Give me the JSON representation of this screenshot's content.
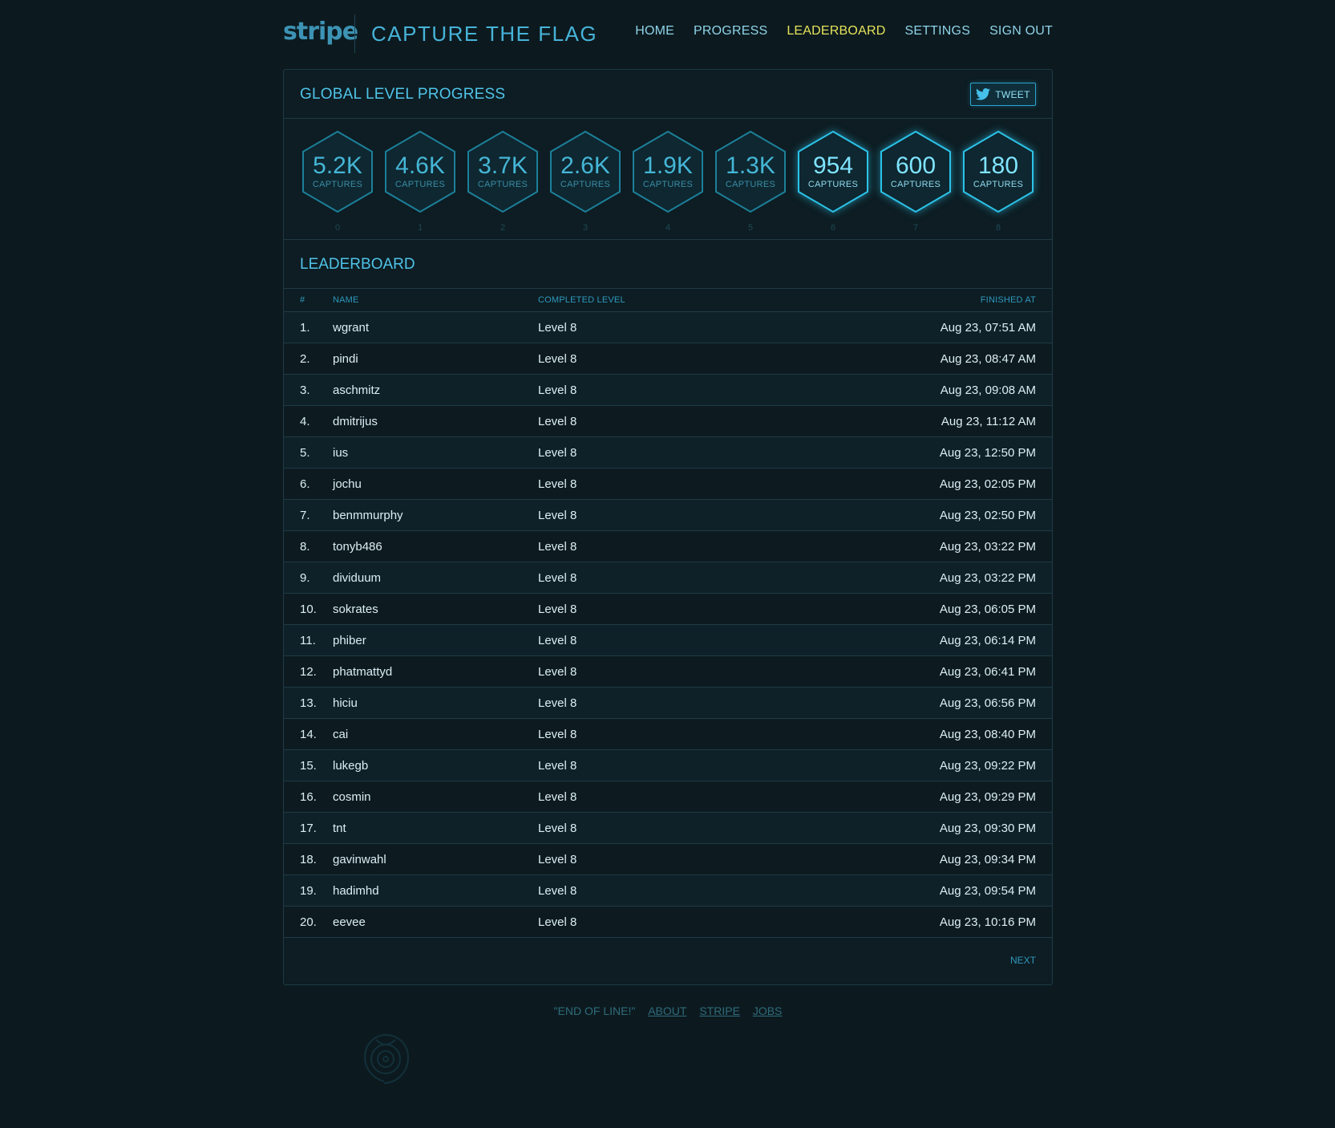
{
  "header": {
    "logo": "stripe",
    "title": "CAPTURE THE FLAG",
    "nav": [
      {
        "label": "HOME",
        "active": false
      },
      {
        "label": "PROGRESS",
        "active": false
      },
      {
        "label": "LEADERBOARD",
        "active": true
      },
      {
        "label": "SETTINGS",
        "active": false
      },
      {
        "label": "SIGN OUT",
        "active": false
      }
    ]
  },
  "global_progress": {
    "title": "GLOBAL LEVEL PROGRESS",
    "tweet_label": "TWEET",
    "levels": [
      {
        "level": "0",
        "captures": "5.2K",
        "caption": "CAPTURES"
      },
      {
        "level": "1",
        "captures": "4.6K",
        "caption": "CAPTURES"
      },
      {
        "level": "2",
        "captures": "3.7K",
        "caption": "CAPTURES"
      },
      {
        "level": "3",
        "captures": "2.6K",
        "caption": "CAPTURES"
      },
      {
        "level": "4",
        "captures": "1.9K",
        "caption": "CAPTURES"
      },
      {
        "level": "5",
        "captures": "1.3K",
        "caption": "CAPTURES"
      },
      {
        "level": "6",
        "captures": "954",
        "caption": "CAPTURES"
      },
      {
        "level": "7",
        "captures": "600",
        "caption": "CAPTURES"
      },
      {
        "level": "8",
        "captures": "180",
        "caption": "CAPTURES"
      }
    ]
  },
  "leaderboard": {
    "title": "LEADERBOARD",
    "columns": {
      "rank": "#",
      "name": "NAME",
      "level": "COMPLETED LEVEL",
      "finished": "FINISHED AT"
    },
    "rows": [
      {
        "rank": "1.",
        "name": "wgrant",
        "level": "Level 8",
        "finished": "Aug 23, 07:51 AM"
      },
      {
        "rank": "2.",
        "name": "pindi",
        "level": "Level 8",
        "finished": "Aug 23, 08:47 AM"
      },
      {
        "rank": "3.",
        "name": "aschmitz",
        "level": "Level 8",
        "finished": "Aug 23, 09:08 AM"
      },
      {
        "rank": "4.",
        "name": "dmitrijus",
        "level": "Level 8",
        "finished": "Aug 23, 11:12 AM"
      },
      {
        "rank": "5.",
        "name": "ius",
        "level": "Level 8",
        "finished": "Aug 23, 12:50 PM"
      },
      {
        "rank": "6.",
        "name": "jochu",
        "level": "Level 8",
        "finished": "Aug 23, 02:05 PM"
      },
      {
        "rank": "7.",
        "name": "benmmurphy",
        "level": "Level 8",
        "finished": "Aug 23, 02:50 PM"
      },
      {
        "rank": "8.",
        "name": "tonyb486",
        "level": "Level 8",
        "finished": "Aug 23, 03:22 PM"
      },
      {
        "rank": "9.",
        "name": "dividuum",
        "level": "Level 8",
        "finished": "Aug 23, 03:22 PM"
      },
      {
        "rank": "10.",
        "name": "sokrates",
        "level": "Level 8",
        "finished": "Aug 23, 06:05 PM"
      },
      {
        "rank": "11.",
        "name": "phiber",
        "level": "Level 8",
        "finished": "Aug 23, 06:14 PM"
      },
      {
        "rank": "12.",
        "name": "phatmattyd",
        "level": "Level 8",
        "finished": "Aug 23, 06:41 PM"
      },
      {
        "rank": "13.",
        "name": "hiciu",
        "level": "Level 8",
        "finished": "Aug 23, 06:56 PM"
      },
      {
        "rank": "14.",
        "name": "cai",
        "level": "Level 8",
        "finished": "Aug 23, 08:40 PM"
      },
      {
        "rank": "15.",
        "name": "lukegb",
        "level": "Level 8",
        "finished": "Aug 23, 09:22 PM"
      },
      {
        "rank": "16.",
        "name": "cosmin",
        "level": "Level 8",
        "finished": "Aug 23, 09:29 PM"
      },
      {
        "rank": "17.",
        "name": "tnt",
        "level": "Level 8",
        "finished": "Aug 23, 09:30 PM"
      },
      {
        "rank": "18.",
        "name": "gavinwahl",
        "level": "Level 8",
        "finished": "Aug 23, 09:34 PM"
      },
      {
        "rank": "19.",
        "name": "hadimhd",
        "level": "Level 8",
        "finished": "Aug 23, 09:54 PM"
      },
      {
        "rank": "20.",
        "name": "eevee",
        "level": "Level 8",
        "finished": "Aug 23, 10:16 PM"
      }
    ],
    "next_label": "NEXT"
  },
  "footer": {
    "quote": "\"END OF LINE!\"",
    "links": [
      "ABOUT",
      "STRIPE",
      "JOBS"
    ]
  },
  "colors": {
    "background": "#0c1a1f",
    "accent": "#4fc3e8",
    "active_nav": "#e6e35a",
    "border": "#1e3a45"
  },
  "icons": {
    "tweet": "twitter-bird-icon",
    "footer": "emblem-icon"
  }
}
